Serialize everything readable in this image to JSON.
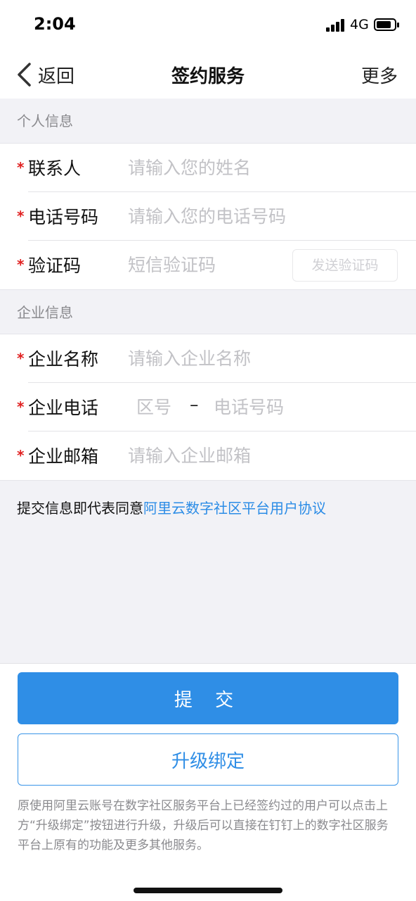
{
  "status": {
    "time": "2:04",
    "network": "4G"
  },
  "nav": {
    "back_label": "返回",
    "title": "签约服务",
    "more_label": "更多"
  },
  "personal": {
    "header": "个人信息",
    "contact": {
      "label": "联系人",
      "placeholder": "请输入您的姓名"
    },
    "phone": {
      "label": "电话号码",
      "placeholder": "请输入您的电话号码"
    },
    "code": {
      "label": "验证码",
      "placeholder": "短信验证码",
      "send_label": "发送验证码"
    }
  },
  "company": {
    "header": "企业信息",
    "name": {
      "label": "企业名称",
      "placeholder": "请输入企业名称"
    },
    "phone": {
      "label": "企业电话",
      "area_placeholder": "区号",
      "dash": "–",
      "number_placeholder": "电话号码"
    },
    "email": {
      "label": "企业邮箱",
      "placeholder": "请输入企业邮箱"
    }
  },
  "required_mark": "*",
  "agreement": {
    "prefix": "提交信息即代表同意",
    "link": "阿里云数字社区平台用户协议"
  },
  "actions": {
    "submit_label": "提 交",
    "upgrade_label": "升级绑定"
  },
  "note": "原使用阿里云账号在数字社区服务平台上已经签约过的用户可以点击上方“升级绑定”按钮进行升级，升级后可以直接在钉钉上的数字社区服务平台上原有的功能及更多其他服务。",
  "colors": {
    "accent": "#2f8ee6",
    "required": "#e02020"
  }
}
